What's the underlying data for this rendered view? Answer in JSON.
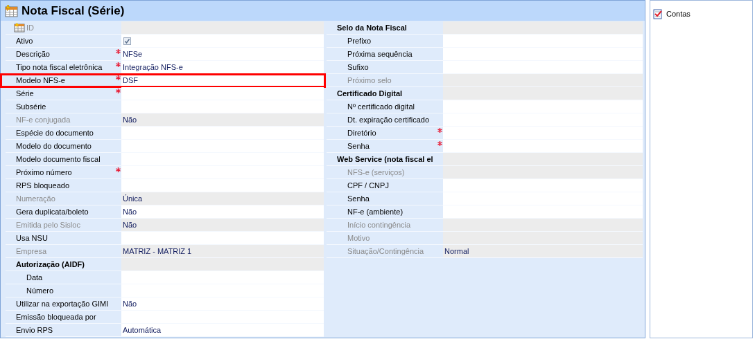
{
  "window": {
    "title": "Nota Fiscal (Série)"
  },
  "left_fields": [
    {
      "kind": "id",
      "label": "ID",
      "disabled": true,
      "required": false,
      "highlighted": false
    },
    {
      "kind": "checkbox",
      "label": "Ativo",
      "checked": true,
      "disabled": false,
      "required": false,
      "highlighted": false
    },
    {
      "kind": "field",
      "label": "Descrição",
      "value": "NFSe",
      "disabled": false,
      "required": true,
      "highlighted": false
    },
    {
      "kind": "field",
      "label": "Tipo nota fiscal eletrônica",
      "value": "Integração NFS-e",
      "disabled": false,
      "required": true,
      "highlighted": false
    },
    {
      "kind": "field",
      "label": "Modelo NFS-e",
      "value": "DSF",
      "disabled": false,
      "required": true,
      "highlighted": true
    },
    {
      "kind": "field",
      "label": "Série",
      "disabled": false,
      "required": true,
      "highlighted": false
    },
    {
      "kind": "field",
      "label": "Subsérie",
      "disabled": false,
      "required": false,
      "highlighted": false
    },
    {
      "kind": "field",
      "label": "NF-e conjugada",
      "value": "Não",
      "disabled": true,
      "required": false,
      "highlighted": false
    },
    {
      "kind": "field",
      "label": "Espécie do documento",
      "disabled": false,
      "required": false,
      "highlighted": false
    },
    {
      "kind": "field",
      "label": "Modelo do documento",
      "disabled": false,
      "required": false,
      "highlighted": false
    },
    {
      "kind": "field",
      "label": "Modelo documento fiscal",
      "disabled": false,
      "required": false,
      "highlighted": false
    },
    {
      "kind": "field",
      "label": "Próximo número",
      "disabled": false,
      "required": true,
      "highlighted": false
    },
    {
      "kind": "field",
      "label": "RPS bloqueado",
      "disabled": false,
      "required": false,
      "highlighted": false
    },
    {
      "kind": "field",
      "label": "Numeração",
      "value": "Única",
      "disabled": true,
      "required": false,
      "highlighted": false
    },
    {
      "kind": "field",
      "label": "Gera duplicata/boleto",
      "value": "Não",
      "disabled": false,
      "required": false,
      "highlighted": false
    },
    {
      "kind": "field",
      "label": "Emitida pelo Sisloc",
      "value": "Não",
      "disabled": true,
      "required": false,
      "highlighted": false
    },
    {
      "kind": "field",
      "label": "Usa NSU",
      "disabled": false,
      "required": false,
      "highlighted": false
    },
    {
      "kind": "field",
      "label": "Empresa",
      "value": "MATRIZ - MATRIZ 1",
      "disabled": true,
      "required": false,
      "highlighted": false
    },
    {
      "kind": "section",
      "label": "Autorização (AIDF)",
      "disabled": false,
      "required": false,
      "highlighted": false,
      "children": [
        {
          "kind": "field",
          "label": "Data",
          "disabled": false,
          "required": false,
          "highlighted": false
        },
        {
          "kind": "field",
          "label": "Número",
          "disabled": false,
          "required": false,
          "highlighted": false
        }
      ]
    },
    {
      "kind": "field",
      "label": "Utilizar na exportação GIMI",
      "value": "Não",
      "disabled": false,
      "required": false,
      "highlighted": false
    },
    {
      "kind": "field",
      "label": "Emissão bloqueada por",
      "disabled": false,
      "required": false,
      "highlighted": false
    },
    {
      "kind": "field",
      "label": "Envio RPS",
      "value": "Automática",
      "disabled": false,
      "required": false,
      "highlighted": false
    }
  ],
  "right_fields": [
    {
      "kind": "section",
      "label": "Selo da Nota Fiscal",
      "disabled": false,
      "required": false,
      "highlighted": false,
      "children": [
        {
          "kind": "field",
          "label": "Prefixo",
          "disabled": false,
          "required": false,
          "highlighted": false
        },
        {
          "kind": "field",
          "label": "Próxima sequência",
          "disabled": false,
          "required": false,
          "highlighted": false
        },
        {
          "kind": "field",
          "label": "Sufixo",
          "disabled": false,
          "required": false,
          "highlighted": false
        },
        {
          "kind": "field",
          "label": "Próximo selo",
          "disabled": true,
          "required": false,
          "highlighted": false
        }
      ]
    },
    {
      "kind": "section",
      "label": "Certificado Digital",
      "disabled": false,
      "required": false,
      "highlighted": false,
      "children": [
        {
          "kind": "field",
          "label": "Nº certificado digital",
          "disabled": false,
          "required": false,
          "highlighted": false
        },
        {
          "kind": "field",
          "label": "Dt. expiração certificado",
          "disabled": false,
          "required": false,
          "highlighted": false
        },
        {
          "kind": "field",
          "label": "Diretório",
          "disabled": false,
          "required": true,
          "highlighted": false
        },
        {
          "kind": "field",
          "label": "Senha",
          "disabled": false,
          "required": true,
          "highlighted": false
        }
      ]
    },
    {
      "kind": "section",
      "label": "Web Service (nota fiscal el",
      "disabled": false,
      "required": false,
      "highlighted": false,
      "children": [
        {
          "kind": "field",
          "label": "NFS-e (serviços)",
          "disabled": true,
          "required": false,
          "highlighted": false
        },
        {
          "kind": "field",
          "label": "CPF / CNPJ",
          "disabled": false,
          "required": false,
          "highlighted": false
        },
        {
          "kind": "field",
          "label": "Senha",
          "disabled": false,
          "required": false,
          "highlighted": false
        },
        {
          "kind": "field",
          "label": "NF-e (ambiente)",
          "disabled": false,
          "required": false,
          "highlighted": false
        },
        {
          "kind": "field",
          "label": "Início contingência",
          "disabled": true,
          "required": false,
          "highlighted": false
        },
        {
          "kind": "field",
          "label": "Motivo",
          "disabled": true,
          "required": false,
          "highlighted": false
        },
        {
          "kind": "field",
          "label": "Situação/Contingência",
          "value": "Normal",
          "disabled": true,
          "required": false,
          "highlighted": false
        }
      ]
    }
  ],
  "sidebar": {
    "items": [
      {
        "label": "Contas"
      }
    ]
  }
}
